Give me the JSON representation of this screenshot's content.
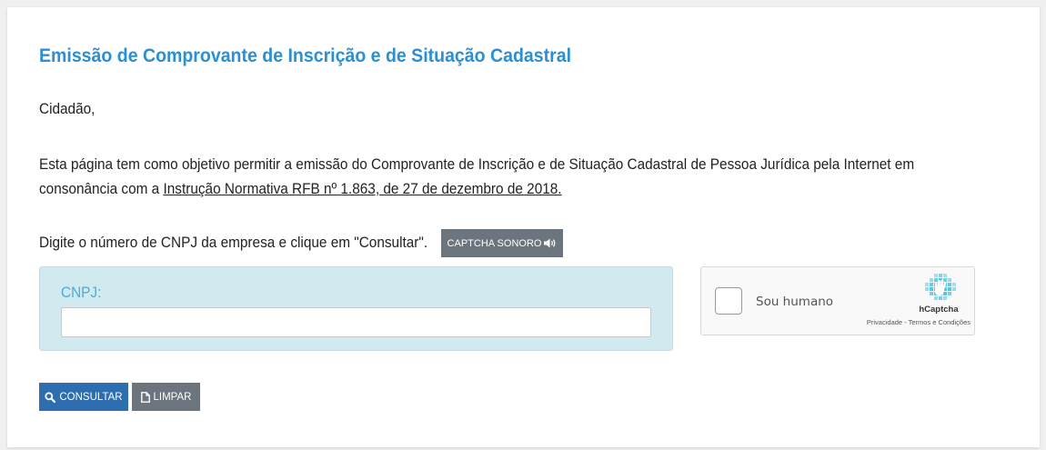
{
  "page": {
    "title": "Emissão de Comprovante de Inscrição e de Situação Cadastral",
    "greeting": "Cidadão,",
    "paragraph_text": "Esta página tem como objetivo permitir a emissão do Comprovante de Inscrição e de Situação Cadastral de Pessoa Jurídica pela Internet em consonância com a ",
    "paragraph_link": "Instrução Normativa RFB nº 1.863, de 27 de dezembro de 2018.",
    "instruction": "Digite o número de CNPJ da empresa e clique em \"Consultar\"."
  },
  "audio_captcha": {
    "label": "CAPTCHA SONORO",
    "icon": "volume-icon"
  },
  "form": {
    "cnpj_label": "CNPJ:",
    "cnpj_value": "",
    "cnpj_placeholder": ""
  },
  "captcha": {
    "label": "Sou humano",
    "brand": "hCaptcha",
    "privacy_link": "Privacidade",
    "separator": " - ",
    "terms_link": "Termos e Condições",
    "logo_icon": "hcaptcha-logo-icon"
  },
  "actions": {
    "consultar_label": "CONSULTAR",
    "consultar_icon": "search-icon",
    "limpar_label": "LIMPAR",
    "limpar_icon": "document-icon"
  },
  "colors": {
    "title": "#2b8fd4",
    "panel_bg": "#d1eaf0",
    "primary_button": "#2c6eaf",
    "secondary_button": "#6c757d"
  }
}
